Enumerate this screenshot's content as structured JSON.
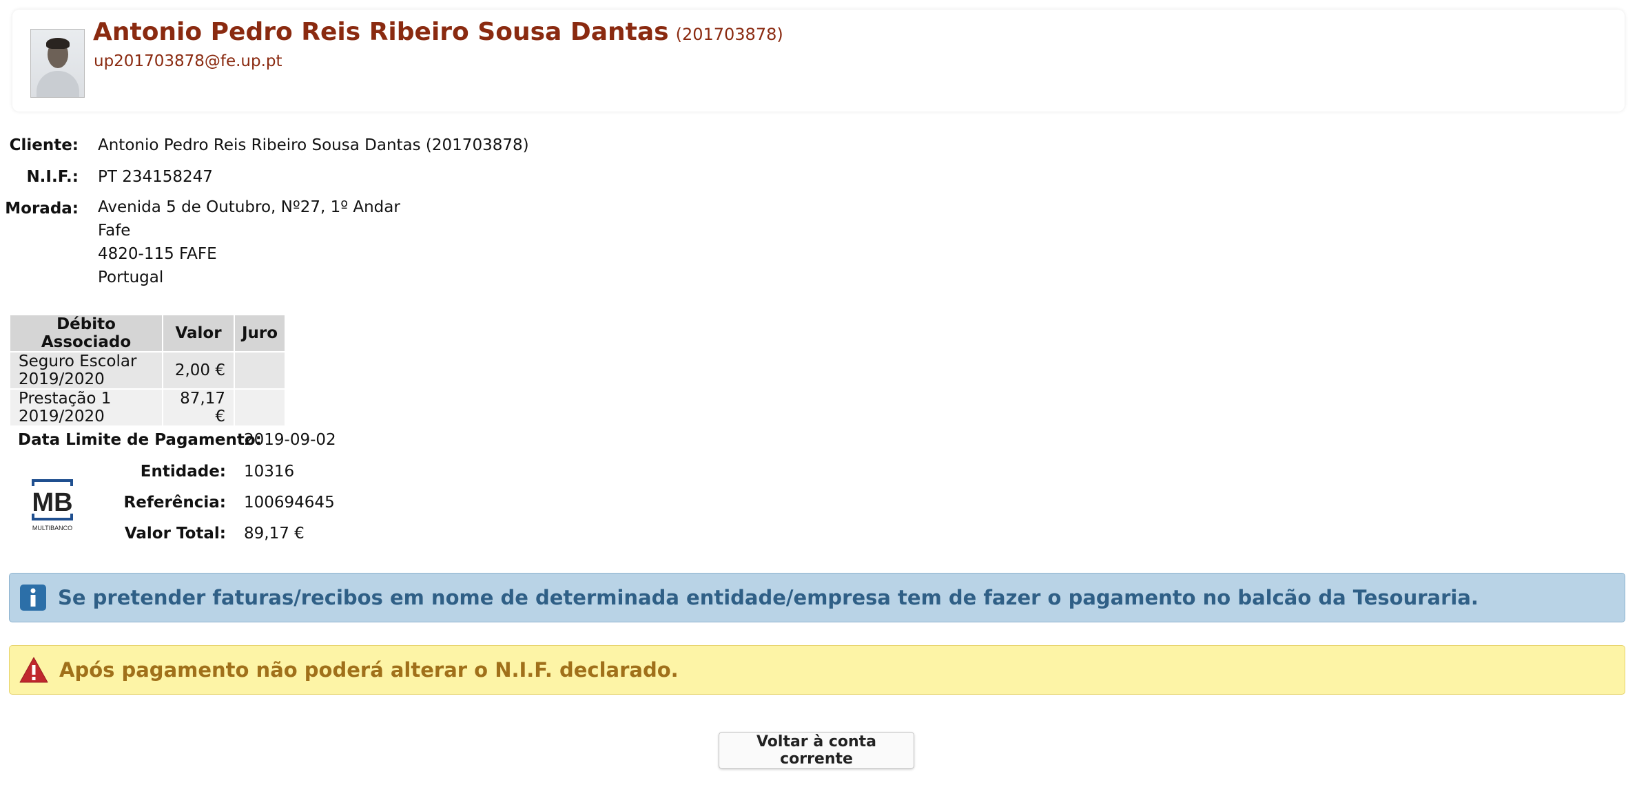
{
  "header": {
    "name": "Antonio Pedro Reis Ribeiro Sousa Dantas",
    "student_number": "(201703878)",
    "email": "up201703878@fe.up.pt"
  },
  "client_info": {
    "cliente_label": "Cliente:",
    "cliente_value": "Antonio Pedro Reis Ribeiro Sousa Dantas (201703878)",
    "nif_label": "N.I.F.:",
    "nif_value": "PT 234158247",
    "morada_label": "Morada:",
    "morada_lines": [
      "Avenida 5 de Outubro, Nº27, 1º Andar",
      "Fafe",
      "4820-115 FAFE",
      "Portugal"
    ]
  },
  "debt_table": {
    "headers": [
      "Débito Associado",
      "Valor",
      "Juro"
    ],
    "rows": [
      [
        "Seguro Escolar 2019/2020",
        "2,00 €",
        ""
      ],
      [
        "Prestação 1 2019/2020",
        "87,17 €",
        ""
      ]
    ]
  },
  "payment": {
    "deadline_label": "Data Limite de Pagamento:",
    "deadline_value": "2019-09-02",
    "entity_label": "Entidade:",
    "entity_value": "10316",
    "reference_label": "Referência:",
    "reference_value": "100694645",
    "total_label": "Valor Total:",
    "total_value": "89,17 €",
    "logo_text": "MB",
    "logo_caption": "MULTIBANCO"
  },
  "alerts": {
    "info_text": "Se pretender faturas/recibos em nome de determinada entidade/empresa tem de fazer o pagamento no balcão da Tesouraria.",
    "warning_text": "Após pagamento não poderá alterar o N.I.F. declarado."
  },
  "back_button_label": "Voltar à conta corrente",
  "colors": {
    "name": "#8a2a10",
    "info_bg": "#b9d3e6",
    "info_text": "#2f5f86",
    "warn_bg": "#fdf4a6",
    "warn_text": "#a0701a",
    "warn_icon": "#c0272d",
    "info_icon": "#2c6fa8"
  },
  "icons": {
    "info": "info-icon",
    "warning": "warning-triangle-icon"
  }
}
